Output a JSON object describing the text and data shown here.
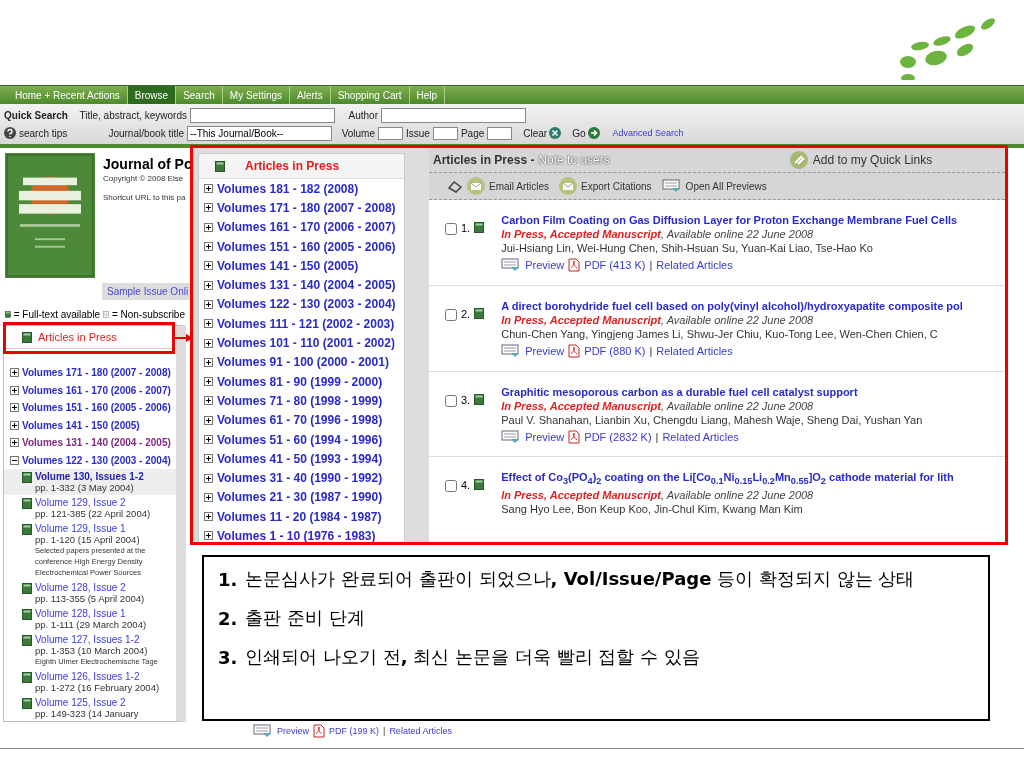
{
  "nav": [
    {
      "label": "Home + Recent Actions",
      "selected": false
    },
    {
      "label": "Browse",
      "selected": true
    },
    {
      "label": "Search",
      "selected": false
    },
    {
      "label": "My Settings",
      "selected": false
    },
    {
      "label": "Alerts",
      "selected": false
    },
    {
      "label": "Shopping Cart",
      "selected": false
    },
    {
      "label": "Help",
      "selected": false
    }
  ],
  "quick_search": {
    "label": "Quick Search",
    "tips": "search tips",
    "keywords_label": "Title, abstract, keywords",
    "author_label": "Author",
    "journal_label": "Journal/book title",
    "journal_value": "--This Journal/Book--",
    "volume_label": "Volume",
    "issue_label": "Issue",
    "page_label": "Page",
    "clear": "Clear",
    "go": "Go",
    "advanced": "Advanced Search"
  },
  "journal": {
    "title": "Journal of Po",
    "copyright": "Copyright © 2008 Else",
    "shortcut": "Shortcut URL to this pa",
    "sample": "Sample Issue Onli"
  },
  "legend": {
    "full": "= Full-text available",
    "non": "= Non-subscribe"
  },
  "sidebar": {
    "heading": "Articles in Press",
    "items": [
      {
        "label": "Volumes 171 - 180 (2007 - 2008)",
        "expanded": false,
        "visited": false
      },
      {
        "label": "Volumes 161 - 170 (2006 - 2007)",
        "expanded": false,
        "visited": false
      },
      {
        "label": "Volumes 151 - 160 (2005 - 2006)",
        "expanded": false,
        "visited": false
      },
      {
        "label": "Volumes 141 - 150 (2005)",
        "expanded": false,
        "visited": false
      },
      {
        "label": "Volumes 131 - 140 (2004 - 2005)",
        "expanded": false,
        "visited": true
      },
      {
        "label": "Volumes 122 - 130 (2003 - 2004)",
        "expanded": true,
        "visited": false,
        "children": [
          {
            "title": "Volume 130, Issues 1-2",
            "pages": "pp. 1-332 (3 May 2004)",
            "selected": true
          },
          {
            "title": "Volume 129, Issue 2",
            "pages": "pp. 121-385 (22 April 2004)",
            "selected": false
          },
          {
            "title": "Volume 129, Issue 1",
            "pages": "pp. 1-120 (15 April 2004)",
            "note": "Selected papers presented at the conference High Energy Density Electrochemical Power Sources",
            "selected": false
          },
          {
            "title": "Volume 128, Issue 2",
            "pages": "pp. 113-355 (5 April 2004)",
            "selected": false
          },
          {
            "title": "Volume 128, Issue 1",
            "pages": "pp. 1-111 (29 March 2004)",
            "selected": false
          },
          {
            "title": "Volume 127, Issues 1-2",
            "pages": "pp. 1-353 (10 March 2004)",
            "note": "Eighth Ulmer Electrochemische Tage",
            "selected": false
          },
          {
            "title": "Volume 126, Issues 1-2",
            "pages": "pp. 1-272 (16 February 2004)",
            "selected": false
          },
          {
            "title": "Volume 125, Issue 2",
            "pages": "pp. 149-323 (14 January",
            "selected": false
          }
        ]
      }
    ]
  },
  "background_links": {
    "preview": "Preview",
    "pdf": "PDF (199 K)",
    "separator": "|",
    "related": "Related Articles"
  },
  "popup": {
    "volumes_heading": "Articles in Press",
    "volumes": [
      "Volumes 181 - 182 (2008)",
      "Volumes 171 - 180 (2007 - 2008)",
      "Volumes 161 - 170 (2006 - 2007)",
      "Volumes 151 - 160 (2005 - 2006)",
      "Volumes 141 - 150 (2005)",
      "Volumes 131 - 140 (2004 - 2005)",
      "Volumes 122 - 130 (2003 - 2004)",
      "Volumes 111 - 121 (2002 - 2003)",
      "Volumes 101 - 110 (2001 - 2002)",
      "Volumes 91 - 100 (2000 - 2001)",
      "Volumes 81 - 90 (1999 - 2000)",
      "Volumes 71 - 80 (1998 - 1999)",
      "Volumes 61 - 70 (1996 - 1998)",
      "Volumes 51 - 60 (1994 - 1996)",
      "Volumes 41 - 50 (1993 - 1994)",
      "Volumes 31 - 40 (1990 - 1992)",
      "Volumes 21 - 30 (1987 - 1990)",
      "Volumes 11 - 20 (1984 - 1987)",
      "Volumes 1 - 10 (1976 - 1983)"
    ],
    "header_title": "Articles in Press -",
    "header_note": "Note to users",
    "quick_links": "Add to my Quick Links",
    "toolbar": [
      {
        "kind": "mail",
        "label": "Email Articles"
      },
      {
        "kind": "mail",
        "label": "Export Citations"
      },
      {
        "kind": "preview",
        "label": "Open All Previews"
      }
    ],
    "articles": [
      {
        "number": "1.",
        "checked": false,
        "title": "Carbon Film Coating on Gas Diffusion Layer for Proton Exchange Membrane Fuel Cells",
        "status": "In Press, Accepted Manuscript",
        "date": ", Available online 22 June 2008",
        "authors": "Jui-Hsiang Lin, Wei-Hung Chen, Shih-Hsuan Su, Yuan-Kai Liao, Tse-Hao Ko",
        "preview": "Preview",
        "pdf": "PDF (413 K)",
        "separator": "|",
        "related": "Related Articles"
      },
      {
        "number": "2.",
        "checked": false,
        "title": "A direct borohydride fuel cell based on poly(vinyl alcohol)/hydroxyapatite composite pol",
        "status": "In Press, Accepted Manuscript",
        "date": ", Available online 22 June 2008",
        "authors": "Chun-Chen Yang, Yingjeng James Li, Shwu-Jer Chiu, Kuo-Tong Lee, Wen-Chen Chien, C",
        "preview": "Preview",
        "pdf": "PDF (880 K)",
        "separator": "|",
        "related": "Related Articles"
      },
      {
        "number": "3.",
        "checked": false,
        "title": "Graphitic mesoporous carbon as a durable fuel cell catalyst support",
        "status": "In Press, Accepted Manuscript",
        "date": ", Available online 22 June 2008",
        "authors": "Paul V. Shanahan, Lianbin Xu, Chengdu Liang, Mahesh Waje, Sheng Dai, Yushan Yan",
        "preview": "Preview",
        "pdf": "PDF (2832 K)",
        "separator": "|",
        "related": "Related Articles"
      },
      {
        "number": "4.",
        "checked": false,
        "title": "Effect of Co$_{3}$(PO$_{4}$)$_{2}$ coating on the Li[Co$_{0.1}$Ni$_{0.15}$Li$_{0.2}$Mn$_{0.55}$]O$_{2}$ cathode material for lith",
        "status": "In Press, Accepted Manuscript",
        "date": ", Available online 22 June 2008",
        "authors": "Sang Hyo Lee, Bon Keup Koo, Jin-Chul Kim, Kwang Man Kim"
      }
    ]
  },
  "notes": [
    {
      "number": "1.",
      "text": "논문심사가 완료되어 출판이 되었으나**, Vol/Issue/Page** 등이 확정되지 않는 상태"
    },
    {
      "number": "2.",
      "text": "출판 준비 단계"
    },
    {
      "number": "3.",
      "text": "인쇄되어 나오기 전**,** 최신 논문을 더욱 빨리 접할 수 있음"
    }
  ]
}
